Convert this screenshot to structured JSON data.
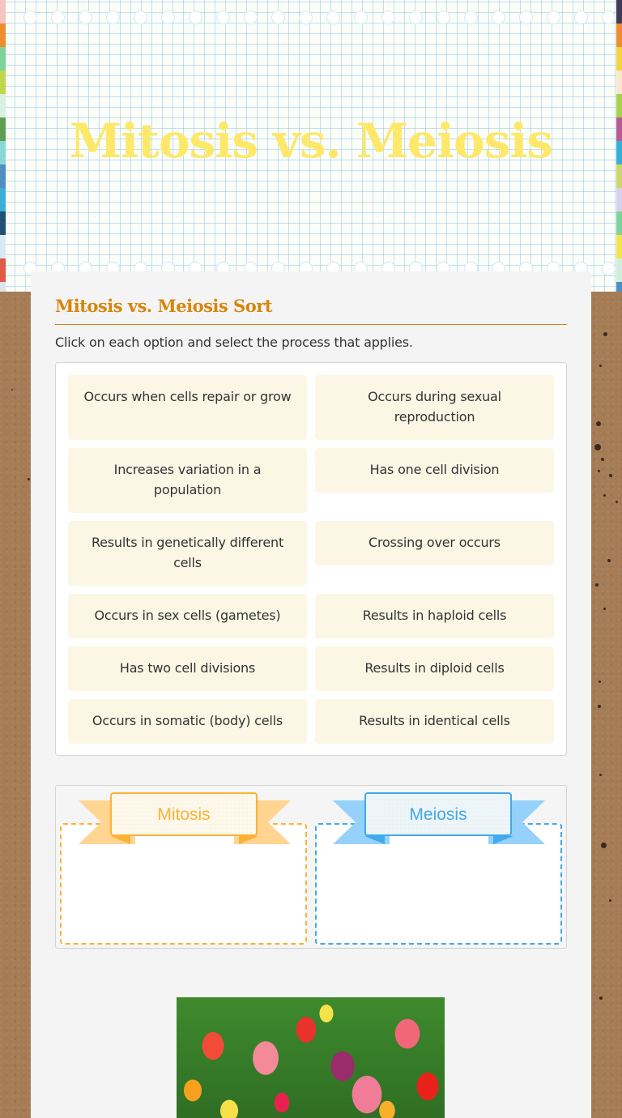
{
  "header": {
    "title": "Mitosis vs. Meiosis",
    "stripe_colors_left": [
      "#f5c5c0",
      "#ef8c2d",
      "#7dd49a",
      "#c0d84a",
      "#d9f0e3",
      "#5f9e52",
      "#88d9d3",
      "#4f8ec2",
      "#3ab0d8",
      "#244f75",
      "#d7eaf4",
      "#de5b45",
      "#dfe3ea"
    ],
    "stripe_colors_right": [
      "#433a58",
      "#ef8c2d",
      "#f3d43f",
      "#fbe6cd",
      "#a7d24a",
      "#b75b98",
      "#38afd9",
      "#ccd66a",
      "#d7d0ea",
      "#7cd49a",
      "#f3e44a",
      "#cfeedd",
      "#4f8ec2"
    ],
    "title_color": "#fde86a"
  },
  "activity": {
    "title": "Mitosis vs. Meiosis Sort",
    "instructions": "Click on each option and select the process that applies.",
    "options": [
      {
        "label": "Occurs when cells repair or grow"
      },
      {
        "label": "Occurs during sexual reproduction"
      },
      {
        "label": "Increases variation in a population"
      },
      {
        "label": "Has one cell division"
      },
      {
        "label": "Results in genetically different cells"
      },
      {
        "label": "Crossing over occurs"
      },
      {
        "label": "Occurs in sex cells (gametes)"
      },
      {
        "label": "Results in haploid cells"
      },
      {
        "label": "Has two cell divisions"
      },
      {
        "label": "Results in diploid cells"
      },
      {
        "label": "Occurs in somatic (body) cells"
      },
      {
        "label": "Results in identical cells"
      }
    ],
    "categories": [
      {
        "label": "Mitosis",
        "color": "#fbb237",
        "ribbon_tail": "#ffd591"
      },
      {
        "label": "Meiosis",
        "color": "#41a9ee",
        "ribbon_tail": "#95d1fb"
      }
    ]
  },
  "image": {
    "description": "Field of colorful tulips"
  }
}
